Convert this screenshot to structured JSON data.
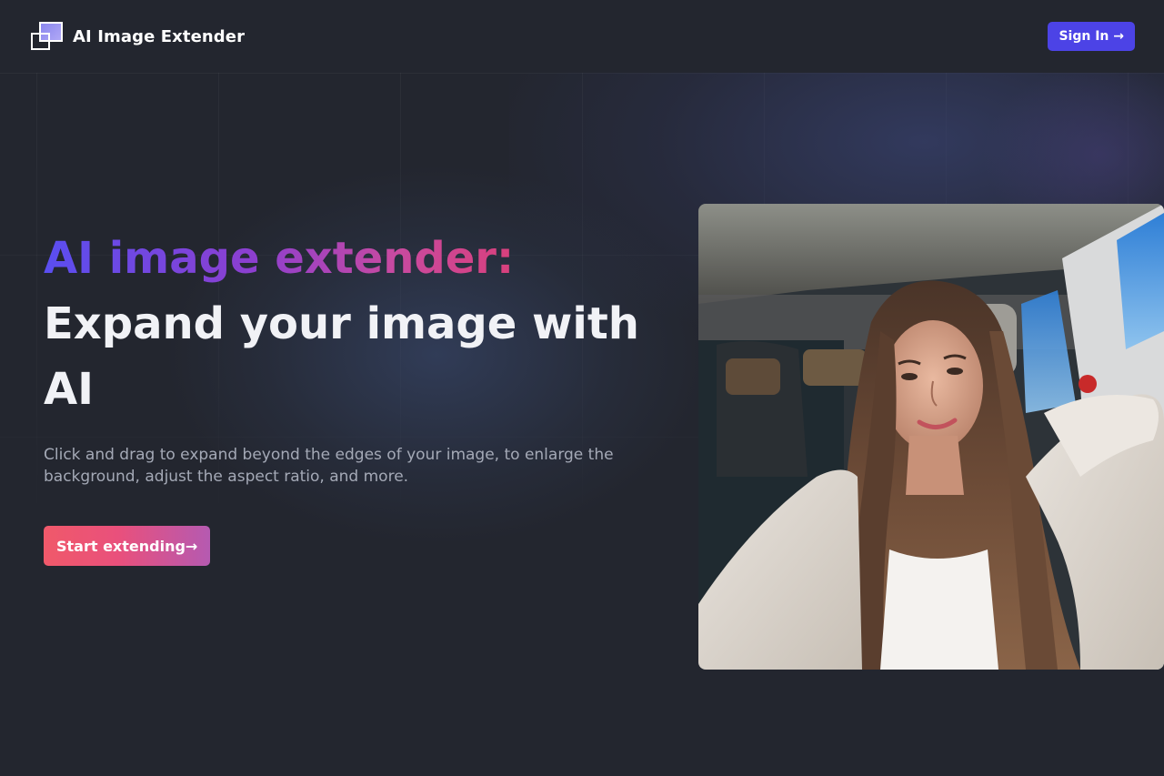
{
  "header": {
    "brand_name": "AI Image Extender",
    "logo_icon": "overlapping-squares-icon",
    "signin_label": "Sign In →"
  },
  "hero": {
    "headline_gradient": "AI image extender:",
    "headline_main": "Expand your image with AI",
    "subtext": "Click and drag to expand beyond the edges of your image, to enlarge the background, adjust the aspect ratio, and more.",
    "cta_label": "Start extending→"
  },
  "colors": {
    "background": "#23262f",
    "accent_button": "#4c43e6",
    "headline_gradient_start": "#5a4ef0",
    "headline_gradient_end": "#d8407c",
    "cta_gradient_start": "#f0596a",
    "cta_gradient_end": "#b55ab1"
  }
}
